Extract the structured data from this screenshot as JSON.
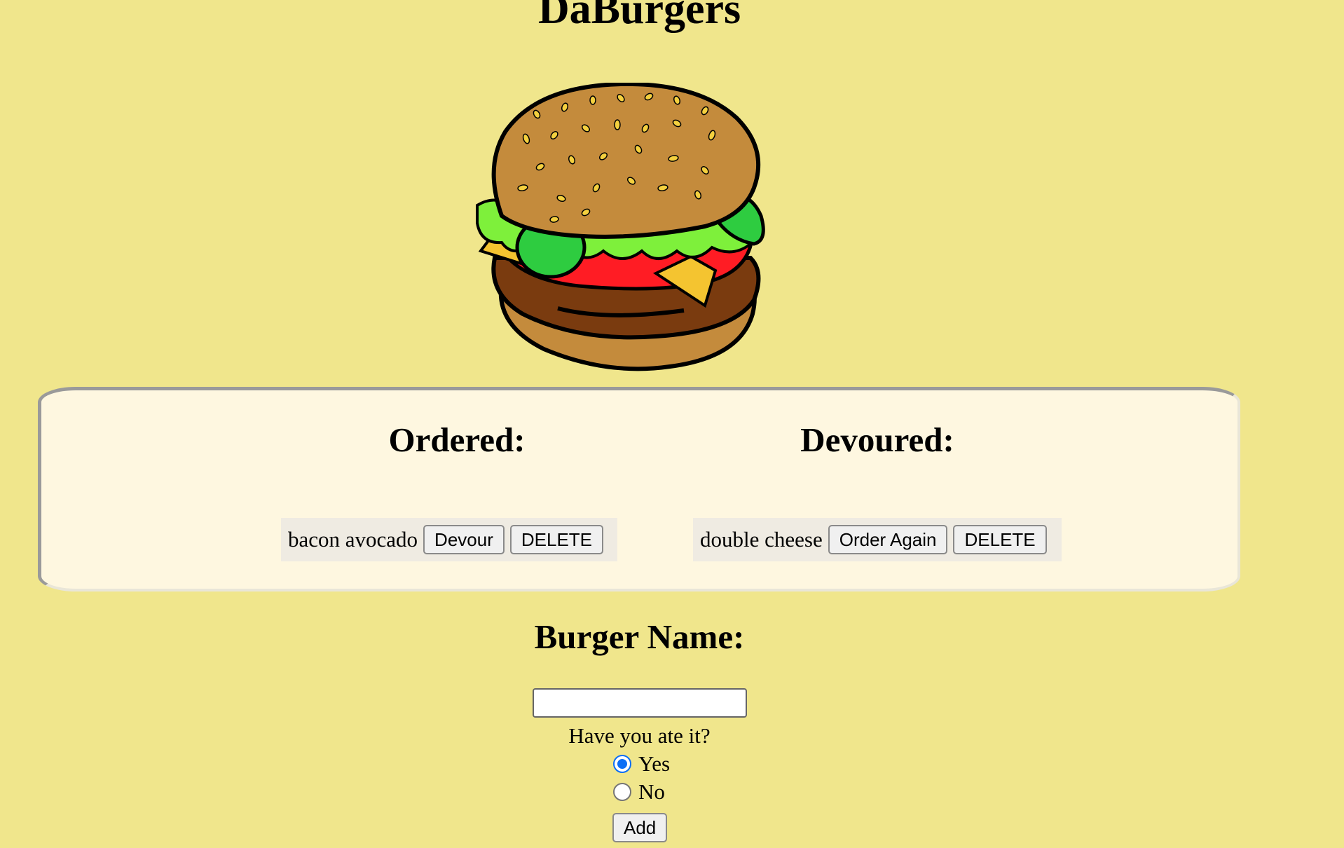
{
  "header": {
    "title": "DaBurgers"
  },
  "hero": {
    "image": "burger-illustration"
  },
  "lists": {
    "ordered": {
      "heading": "Ordered:",
      "items": [
        {
          "name": "bacon avocado",
          "primary_action": "Devour",
          "delete_action": "DELETE"
        }
      ]
    },
    "devoured": {
      "heading": "Devoured:",
      "items": [
        {
          "name": "double cheese",
          "primary_action": "Order Again",
          "delete_action": "DELETE"
        }
      ]
    }
  },
  "form": {
    "heading": "Burger Name:",
    "name_value": "",
    "question": "Have you ate it?",
    "options": [
      {
        "label": "Yes",
        "checked": true
      },
      {
        "label": "No",
        "checked": false
      }
    ],
    "submit_label": "Add"
  },
  "colors": {
    "page_background": "#f0e68c",
    "panel_background": "#fef7e0",
    "radio_accent": "#0b6ef5"
  }
}
